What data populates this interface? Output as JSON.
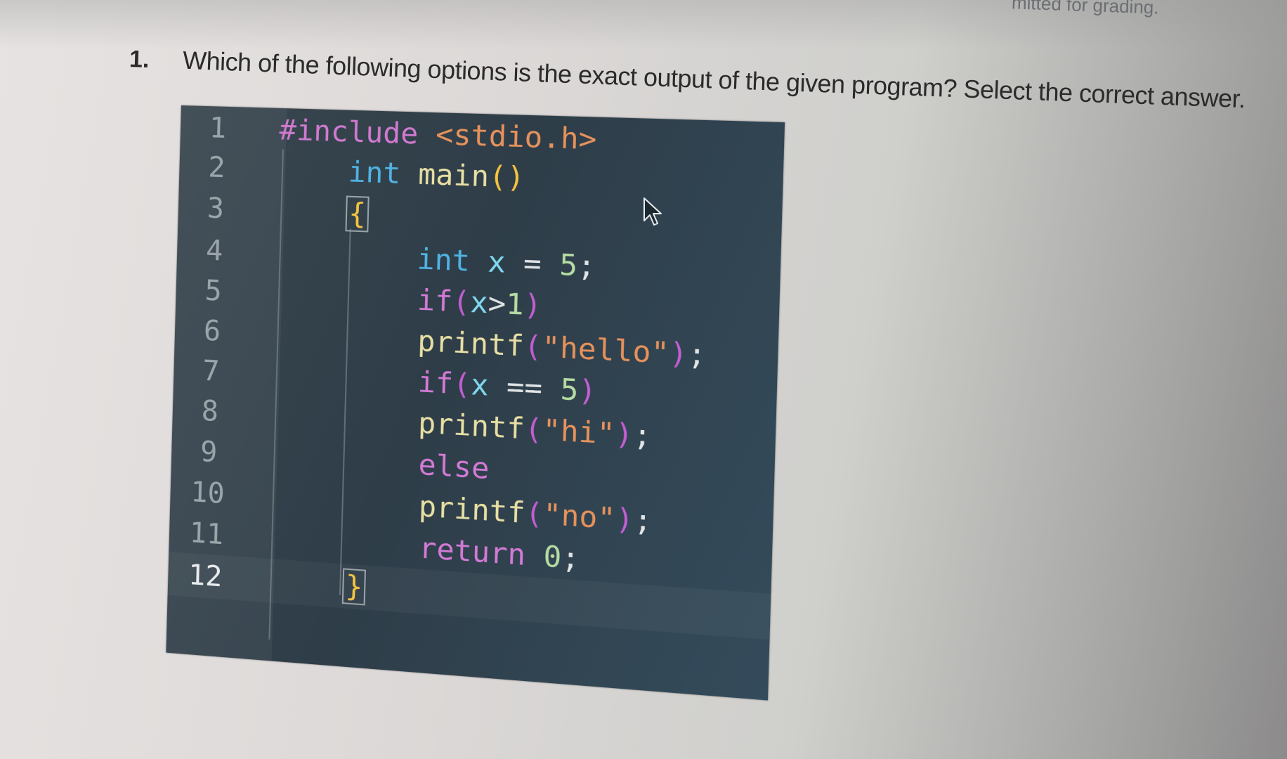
{
  "header": {
    "top_note": "mitted for grading."
  },
  "question": {
    "number": "1.",
    "text": "Which of the following options is the exact output of the given program? Select the correct answer."
  },
  "code": {
    "language": "c",
    "lines": [
      {
        "n": "1",
        "text": "#include <stdio.h>"
      },
      {
        "n": "2",
        "text": "int main()"
      },
      {
        "n": "3",
        "text": "{"
      },
      {
        "n": "4",
        "text": "int x = 5;"
      },
      {
        "n": "5",
        "text": "if(x>1)"
      },
      {
        "n": "6",
        "text": "printf(\"hello\");"
      },
      {
        "n": "7",
        "text": "if(x == 5)"
      },
      {
        "n": "8",
        "text": "printf(\"hi\");"
      },
      {
        "n": "9",
        "text": "else"
      },
      {
        "n": "10",
        "text": "printf(\"no\");"
      },
      {
        "n": "11",
        "text": "return 0;"
      },
      {
        "n": "12",
        "text": "}"
      }
    ],
    "active_line": "12",
    "tokens": {
      "l1": [
        "#include",
        " ",
        "<stdio.h>"
      ],
      "l2": [
        "int",
        " ",
        "main",
        "(",
        ")"
      ],
      "l3": [
        "{"
      ],
      "l4": [
        "int",
        " ",
        "x",
        " = ",
        "5",
        ";"
      ],
      "l5": [
        "if",
        "(",
        "x",
        ">",
        "1",
        ")"
      ],
      "l6": [
        "printf",
        "(",
        "\"hello\"",
        ")",
        ";"
      ],
      "l7": [
        "if",
        "(",
        "x",
        " == ",
        "5",
        ")"
      ],
      "l8": [
        "printf",
        "(",
        "\"hi\"",
        ")",
        ";"
      ],
      "l9": [
        "else"
      ],
      "l10": [
        "printf",
        "(",
        "\"no\"",
        ")",
        ";"
      ],
      "l11": [
        "return",
        " ",
        "0",
        ";"
      ],
      "l12": [
        "}"
      ]
    }
  },
  "colors": {
    "editor_bg": "#2e3d48",
    "preprocessor": "#d07ad0",
    "string": "#e6925c",
    "type": "#4fb3e3",
    "function": "#e8dfa4",
    "keyword": "#d37ad6",
    "number": "#b5dca2",
    "variable": "#7fd8f0"
  },
  "icons": {
    "mouse_cursor": "arrow-pointer"
  }
}
